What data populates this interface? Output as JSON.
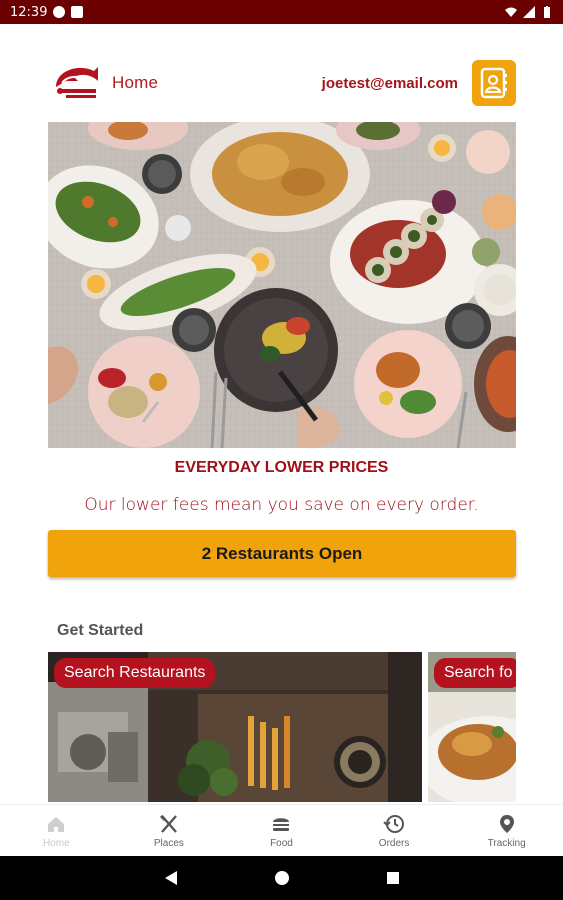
{
  "status_bar": {
    "time": "12:39"
  },
  "header": {
    "home_label": "Home",
    "email": "joetest@email.com"
  },
  "promo": {
    "title": "EVERYDAY LOWER PRICES",
    "subtitle": "Our lower fees mean you save on every order."
  },
  "open_button": {
    "label": "2  Restaurants Open"
  },
  "get_started": {
    "title": "Get Started",
    "cards": [
      {
        "label": "Search Restaurants"
      },
      {
        "label": "Search fo"
      }
    ]
  },
  "bottom_nav": {
    "items": [
      {
        "label": "Home",
        "icon": "home-icon"
      },
      {
        "label": "Places",
        "icon": "utensils-icon"
      },
      {
        "label": "Food",
        "icon": "burger-icon"
      },
      {
        "label": "Orders",
        "icon": "history-icon"
      },
      {
        "label": "Tracking",
        "icon": "location-pin-icon"
      }
    ]
  },
  "colors": {
    "brand_red": "#a01018",
    "accent_orange": "#f0a30a",
    "status_bar": "#6b0000"
  }
}
